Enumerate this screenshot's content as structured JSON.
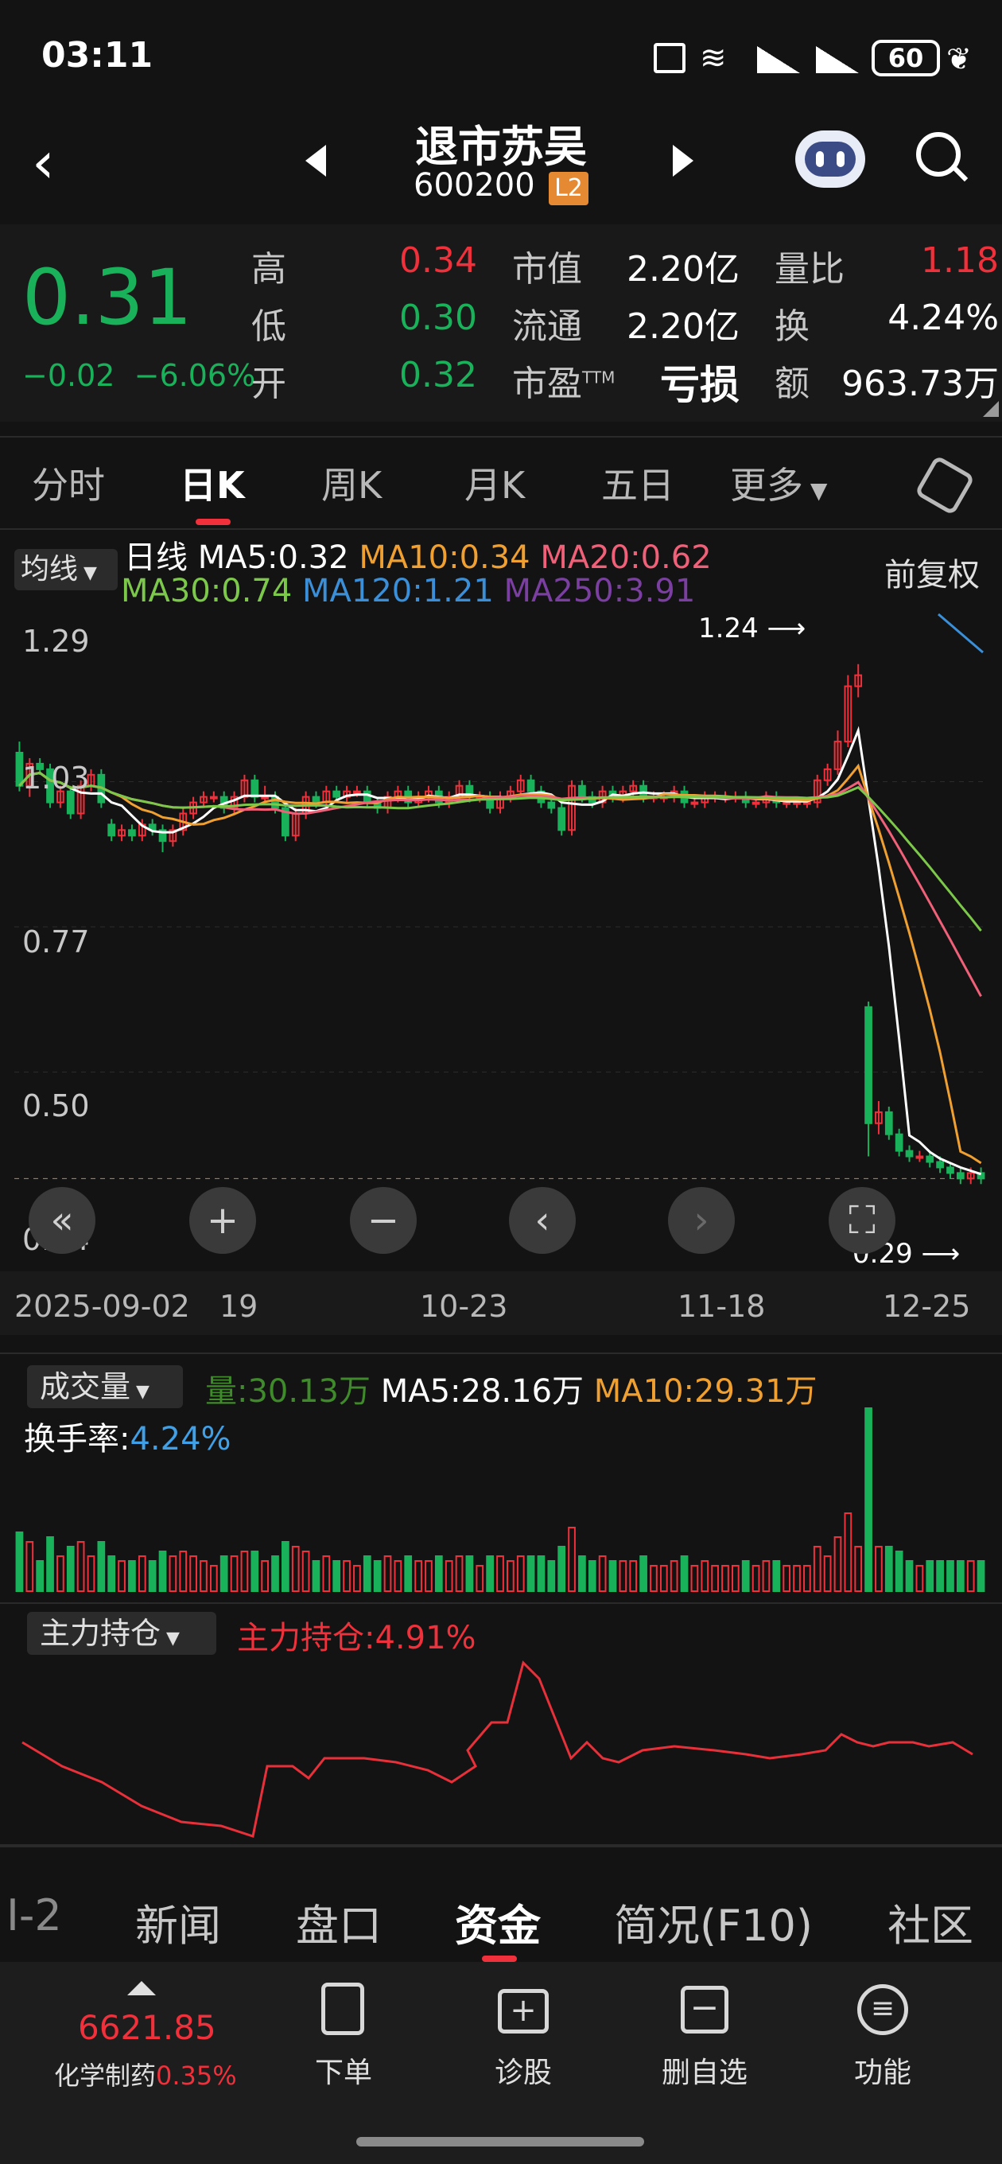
{
  "status_bar": {
    "time": "03:11",
    "battery": "60"
  },
  "header": {
    "name": "退市苏吴",
    "code": "600200",
    "level": "L2"
  },
  "quote": {
    "price": "0.31",
    "change": "−0.02",
    "change_pct": "−6.06%",
    "rows": [
      {
        "l1": "高",
        "v1": "0.34",
        "l2": "市值",
        "v2": "2.20亿",
        "l3": "量比",
        "v3": "1.18"
      },
      {
        "l1": "低",
        "v1": "0.30",
        "l2": "流通",
        "v2": "2.20亿",
        "l3": "换",
        "v3": "4.24%"
      },
      {
        "l1": "开",
        "v1": "0.32",
        "l2": "市盈",
        "v2": "亏损",
        "l3": "额",
        "v3": "963.73万"
      }
    ],
    "pe_sup": "TTM"
  },
  "tabs": [
    "分时",
    "日K",
    "周K",
    "月K",
    "五日",
    "更多"
  ],
  "active_tab": "日K",
  "ma": {
    "selector": "均线",
    "line_label": "日线",
    "ma5": "MA5:0.32",
    "ma10": "MA10:0.34",
    "ma20": "MA20:0.62",
    "ma30": "MA30:0.74",
    "ma120": "MA120:1.21",
    "ma250": "MA250:3.91",
    "adjust": "前复权"
  },
  "colors": {
    "up": "#f0303a",
    "down": "#19b25a",
    "ma5": "#ffffff",
    "ma10": "#f0a030",
    "ma20": "#f06078",
    "ma30": "#7cc84a",
    "ma120": "#3a8fd8",
    "ma250": "#7a3fa0"
  },
  "chart": {
    "y_ticks": [
      "1.29",
      "1.03",
      "0.77",
      "0.50",
      "0.24"
    ],
    "high_marker": "1.24",
    "low_marker": "0.29",
    "x_ticks": [
      "2025-09-02",
      "19",
      "10-23",
      "11-18",
      "12-25"
    ]
  },
  "chart_data": {
    "type": "candlestick",
    "open": [
      1.08,
      1.02,
      1.06,
      1.05,
      0.99,
      1.01,
      0.97,
      1.02,
      1.04,
      0.95,
      0.93,
      0.94,
      0.93,
      0.95,
      0.94,
      0.92,
      0.94,
      0.97,
      0.99,
      1.0,
      1.0,
      0.98,
      1.0,
      1.03,
      1.0,
      1.0,
      0.98,
      0.93,
      0.97,
      1.0,
      0.99,
      1.01,
      1.0,
      1.01,
      1.01,
      0.99,
      0.98,
      1.0,
      1.01,
      0.99,
      1.0,
      1.01,
      0.99,
      1.0,
      1.02,
      1.0,
      1.0,
      0.98,
      1.0,
      1.01,
      1.03,
      1.01,
      0.99,
      0.98,
      0.94,
      1.02,
      1.0,
      0.99,
      1.01,
      1.0,
      1.01,
      1.02,
      1.0,
      1.0,
      1.0,
      1.01,
      0.99,
      0.99,
      1.0,
      1.0,
      1.0,
      1.0,
      0.99,
      0.99,
      1.0,
      0.99,
      0.99,
      0.99,
      0.99,
      1.03,
      1.05,
      1.1,
      1.2,
      0.62,
      0.41,
      0.43,
      0.39,
      0.36,
      0.35,
      0.35,
      0.34,
      0.33,
      0.32,
      0.31,
      0.32
    ],
    "close": [
      1.02,
      1.06,
      1.05,
      0.99,
      1.01,
      0.97,
      1.02,
      1.04,
      0.99,
      0.93,
      0.94,
      0.93,
      0.95,
      0.94,
      0.92,
      0.94,
      0.97,
      0.99,
      1.0,
      1.0,
      0.98,
      1.0,
      1.03,
      1.0,
      1.0,
      0.98,
      0.93,
      0.97,
      1.0,
      0.99,
      1.01,
      1.0,
      1.01,
      1.01,
      0.99,
      0.98,
      1.0,
      1.01,
      0.99,
      1.0,
      1.01,
      0.99,
      1.0,
      1.02,
      1.0,
      1.0,
      0.98,
      1.0,
      1.01,
      1.03,
      1.01,
      0.99,
      0.98,
      0.94,
      1.02,
      1.0,
      0.99,
      1.01,
      1.0,
      1.01,
      1.02,
      1.0,
      1.0,
      1.0,
      1.01,
      0.99,
      0.99,
      1.0,
      1.0,
      1.0,
      1.0,
      0.99,
      0.99,
      1.0,
      0.99,
      0.99,
      0.99,
      0.99,
      1.03,
      1.05,
      1.1,
      1.2,
      1.22,
      0.41,
      0.43,
      0.39,
      0.36,
      0.35,
      0.35,
      0.34,
      0.33,
      0.32,
      0.31,
      0.32,
      0.31
    ],
    "high": [
      1.1,
      1.07,
      1.07,
      1.06,
      1.02,
      1.02,
      1.03,
      1.05,
      1.05,
      0.96,
      0.95,
      0.95,
      0.96,
      0.96,
      0.95,
      0.95,
      0.98,
      1.0,
      1.01,
      1.01,
      1.01,
      1.01,
      1.04,
      1.04,
      1.02,
      1.01,
      0.99,
      0.98,
      1.01,
      1.01,
      1.02,
      1.02,
      1.02,
      1.02,
      1.02,
      1.0,
      1.01,
      1.02,
      1.02,
      1.01,
      1.02,
      1.02,
      1.01,
      1.03,
      1.03,
      1.01,
      1.01,
      1.01,
      1.02,
      1.04,
      1.04,
      1.02,
      1.0,
      0.99,
      1.03,
      1.03,
      1.01,
      1.02,
      1.02,
      1.02,
      1.03,
      1.03,
      1.01,
      1.01,
      1.02,
      1.02,
      1.0,
      1.01,
      1.01,
      1.01,
      1.01,
      1.01,
      1.0,
      1.01,
      1.01,
      1.0,
      1.0,
      1.0,
      1.04,
      1.06,
      1.12,
      1.22,
      1.24,
      0.63,
      0.45,
      0.44,
      0.4,
      0.37,
      0.36,
      0.36,
      0.35,
      0.34,
      0.33,
      0.33,
      0.33
    ],
    "low": [
      1.01,
      1.0,
      1.04,
      0.98,
      0.98,
      0.96,
      0.96,
      1.01,
      0.98,
      0.92,
      0.92,
      0.92,
      0.92,
      0.93,
      0.9,
      0.91,
      0.93,
      0.96,
      0.98,
      0.99,
      0.97,
      0.97,
      0.99,
      0.99,
      0.99,
      0.97,
      0.92,
      0.92,
      0.96,
      0.98,
      0.98,
      0.99,
      0.99,
      1.0,
      0.98,
      0.97,
      0.97,
      0.99,
      0.98,
      0.98,
      0.99,
      0.98,
      0.98,
      0.99,
      0.99,
      0.99,
      0.97,
      0.97,
      0.99,
      1.0,
      1.0,
      0.98,
      0.97,
      0.93,
      0.93,
      0.99,
      0.98,
      0.98,
      0.99,
      0.99,
      1.0,
      0.99,
      0.99,
      0.99,
      0.99,
      0.98,
      0.98,
      0.98,
      0.99,
      0.99,
      0.99,
      0.98,
      0.98,
      0.98,
      0.98,
      0.98,
      0.98,
      0.98,
      0.98,
      1.02,
      1.04,
      1.09,
      1.18,
      0.35,
      0.39,
      0.38,
      0.35,
      0.34,
      0.34,
      0.33,
      0.32,
      0.31,
      0.3,
      0.3,
      0.3
    ],
    "ylim": [
      0.24,
      1.29
    ],
    "volume": {
      "label": "成交量",
      "current": "量:30.13万",
      "ma5": "MA5:28.16万",
      "ma10": "MA10:29.31万",
      "turnover_label": "换手率:",
      "turnover": "4.24%"
    },
    "holding": {
      "selector": "主力持仓",
      "label": "主力持仓:4.91%"
    }
  },
  "news_tabs": [
    "I-2",
    "新闻",
    "盘口",
    "资金",
    "简况(F10)",
    "社区"
  ],
  "active_news_tab": "资金",
  "bottom_bar": {
    "index_value": "6621.85",
    "index_name": "化学制药",
    "index_change": "0.35%",
    "buttons": [
      "下单",
      "诊股",
      "删自选",
      "功能"
    ]
  }
}
